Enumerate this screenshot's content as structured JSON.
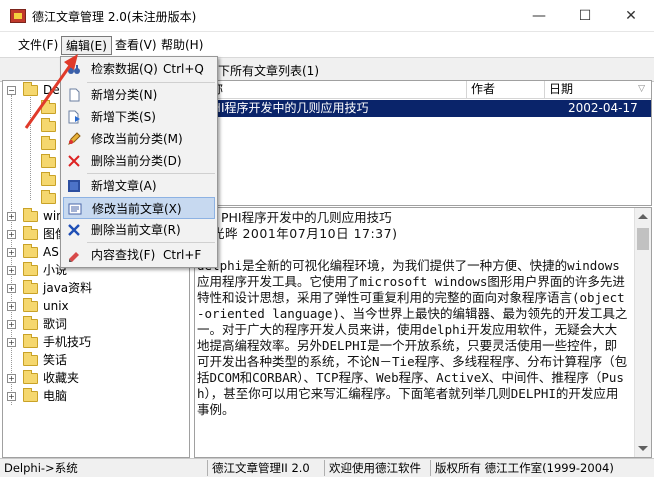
{
  "window": {
    "title": "德江文章管理 2.0(未注册版本)",
    "controls": [
      "—",
      "☐",
      "✕"
    ]
  },
  "menubar": {
    "items": [
      "文件(F)",
      "编辑(E)",
      "查看(V)",
      "帮助(H)"
    ]
  },
  "edit_menu": {
    "items": [
      {
        "label": "检索数据(Q)",
        "shortcut": "Ctrl+Q",
        "icon": "binoculars-icon"
      },
      {
        "label": "新增分类(N)",
        "shortcut": "",
        "icon": "new-page-icon"
      },
      {
        "label": "新增下类(S)",
        "shortcut": "",
        "icon": "new-subcategory-icon"
      },
      {
        "label": "修改当前分类(M)",
        "shortcut": "",
        "icon": "edit-pencil-icon"
      },
      {
        "label": "删除当前分类(D)",
        "shortcut": "",
        "icon": "delete-x-icon"
      },
      {
        "label": "新增文章(A)",
        "shortcut": "",
        "icon": "new-article-icon"
      },
      {
        "label": "修改当前文章(X)",
        "shortcut": "",
        "icon": "edit-article-icon"
      },
      {
        "label": "删除当前文章(R)",
        "shortcut": "",
        "icon": "delete-article-icon"
      },
      {
        "label": "内容查找(F)",
        "shortcut": "Ctrl+F",
        "icon": "find-content-icon"
      }
    ]
  },
  "tree": {
    "top_label": "Del",
    "items": [
      "win",
      "图像",
      "ASP",
      "小说",
      "java资料",
      "unix",
      "歌词",
      "手机技巧",
      "笑话",
      "收藏夹",
      "电脑"
    ]
  },
  "list": {
    "caption": "类别下所有文章列表(1)",
    "columns": [
      "名称",
      "作者",
      "日期"
    ],
    "rows": [
      {
        "name": "LPHI程序开发中的几则应用技巧",
        "author": "",
        "date": "2002-04-17"
      }
    ]
  },
  "article": {
    "title_line": "PHI程序开发中的几则应用技巧",
    "meta_line": "川光晔    2001年07月10日 17:37)",
    "body": "delphi是全新的可视化编程环境，为我们提供了一种方便、快捷的windows应用程序开发工具。它使用了microsoft windows图形用户界面的许多先进特性和设计思想，采用了弹性可重复利用的完整的面向对象程序语言(object-oriented language)、当今世界上最快的编辑器、最为领先的开发工具之一。对于广大的程序开发人员来讲，使用delphi开发应用软件，无疑会大大地提高编程效率。另外DELPHI是一个开放系统，只要灵活使用一些控件，即可开发出各种类型的系统，不论N－Tie程序、多线程程序、分布计算程序（包括DCOM和CORBAR）、TCP程序、Web程序、ActiveX、中间件、推程序（Push），甚至你可以用它来写汇编程序。下面笔者就列举几则DELPHI的开发应用事例。"
  },
  "statusbar": {
    "path": "Delphi->系统",
    "app": "德江文章管理II 2.0",
    "welcome": "欢迎使用德江软件",
    "copyright": "版权所有 德江工作室(1999-2004)"
  },
  "colors": {
    "selection": "#0a246a",
    "menu_highlight": "#c7d9f0",
    "annotation_arrow": "#e03a2a"
  }
}
